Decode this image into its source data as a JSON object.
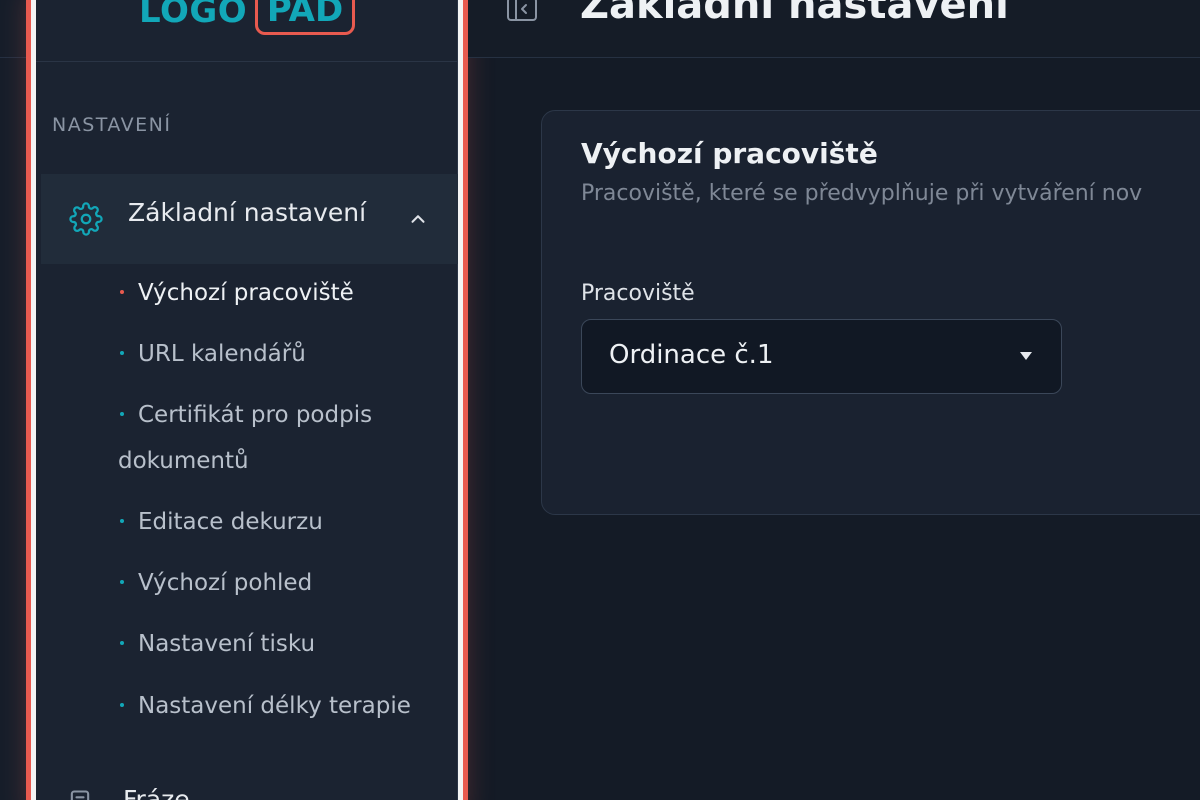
{
  "logo": {
    "text": "LOGO",
    "badge": "PAD"
  },
  "sidebar": {
    "section_label": "NASTAVENÍ",
    "parent": {
      "label": "Základní nastavení",
      "icon": "gear-icon",
      "expanded": true
    },
    "items": [
      {
        "label": "Výchozí pracoviště",
        "active": true
      },
      {
        "label": "URL kalendářů",
        "active": false
      },
      {
        "label": "Certifikát pro podpis dokumentů",
        "active": false
      },
      {
        "label": "Editace dekurzu",
        "active": false
      },
      {
        "label": "Výchozí pohled",
        "active": false
      },
      {
        "label": "Nastavení tisku",
        "active": false
      },
      {
        "label": "Nastavení délky terapie",
        "active": false
      }
    ],
    "next": {
      "label": "Fráze",
      "icon": "document-icon"
    }
  },
  "header": {
    "title": "Základní nastavení"
  },
  "card": {
    "title": "Výchozí pracoviště",
    "description": "Pracoviště, které se předvyplňuje při vytváření nov",
    "field_label": "Pracoviště",
    "select_value": "Ordinace č.1"
  },
  "colors": {
    "accent": "#12a7b8",
    "highlight": "#e85a4f",
    "background": "#141b26"
  }
}
